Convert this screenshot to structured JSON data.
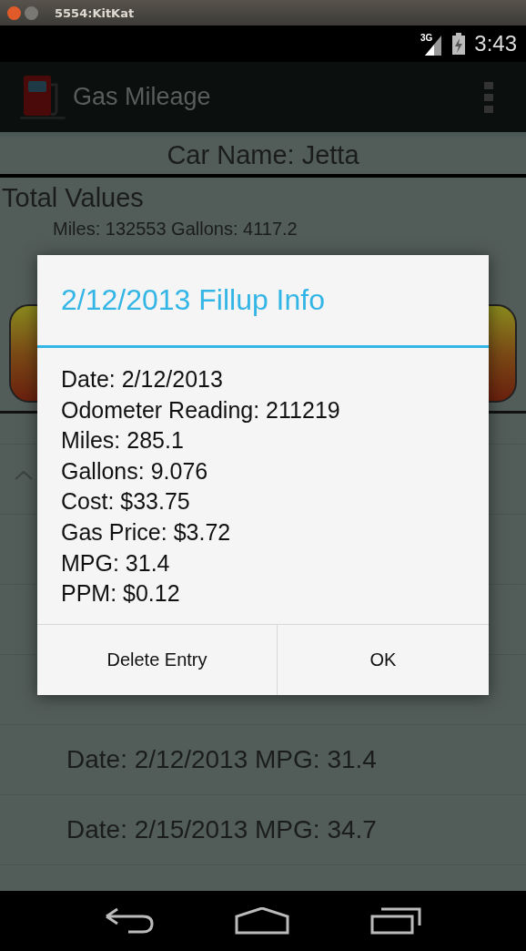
{
  "window": {
    "title": "5554:KitKat"
  },
  "status_bar": {
    "network": "3G",
    "time": "3:43"
  },
  "action_bar": {
    "title": "Gas Mileage"
  },
  "car": {
    "name": "Car Name: Jetta"
  },
  "totals": {
    "heading": "Total Values",
    "line": "Miles: 132553 Gallons: 4117.2"
  },
  "entries": [
    {
      "label": "Date: 2/12/2013 MPG: 31.4"
    },
    {
      "label": "Date: 2/15/2013 MPG: 34.7"
    }
  ],
  "dialog": {
    "title": "2/12/2013 Fillup Info",
    "lines": [
      "Date: 2/12/2013",
      "Odometer Reading: 211219",
      "Miles: 285.1",
      "Gallons: 9.076",
      "Cost: $33.75",
      "Gas Price: $3.72",
      "MPG: 31.4",
      "PPM: $0.12"
    ],
    "buttons": [
      "Delete Entry",
      "OK"
    ]
  }
}
